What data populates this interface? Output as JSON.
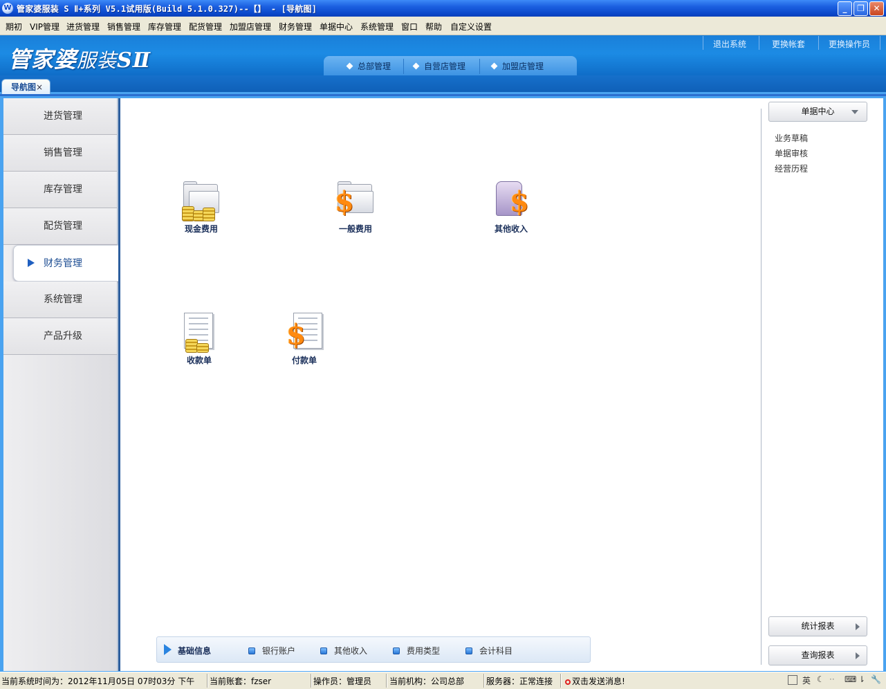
{
  "window": {
    "title": "管家婆服装 S Ⅱ+系列 V5.1试用版(Build 5.1.0.327)--【】 - [导航图]",
    "icon_text": "W",
    "controls": [
      "minimize-icon",
      "restore-icon",
      "close-icon"
    ],
    "accent": "#0a46c8"
  },
  "menubar": {
    "items": [
      "期初",
      "VIP管理",
      "进货管理",
      "销售管理",
      "库存管理",
      "配货管理",
      "加盟店管理",
      "财务管理",
      "单据中心",
      "系统管理",
      "窗口",
      "帮助",
      "自定义设置"
    ]
  },
  "header": {
    "logo": {
      "part1": "管家婆",
      "part2": "服装",
      "part3": "SⅡ"
    },
    "links": [
      "退出系统",
      "更换帐套",
      "更换操作员"
    ],
    "tabs": [
      "总部管理",
      "自营店管理",
      "加盟店管理"
    ]
  },
  "doc_tab": {
    "label": "导航图",
    "close": "×"
  },
  "sidebar": {
    "items": [
      "进货管理",
      "销售管理",
      "库存管理",
      "配货管理",
      "财务管理",
      "系统管理",
      "产品升级"
    ],
    "active": "财务管理"
  },
  "main": {
    "icons": [
      {
        "label": "现金费用",
        "icon": "folder-coins-icon"
      },
      {
        "label": "一般费用",
        "icon": "folder-dollar-icon"
      },
      {
        "label": "其他收入",
        "icon": "shirt-dollar-icon"
      },
      {
        "label": "收款单",
        "icon": "document-coins-icon"
      },
      {
        "label": "付款单",
        "icon": "document-dollar-icon"
      }
    ]
  },
  "right_panel": {
    "doc_center": "单据中心",
    "links": [
      "业务草稿",
      "单据审核",
      "经营历程"
    ],
    "stats_button": "统计报表",
    "query_button": "查询报表"
  },
  "basic_info": {
    "title": "基础信息",
    "items": [
      "银行账户",
      "其他收入",
      "费用类型",
      "会计科目"
    ]
  },
  "statusbar": {
    "time": "当前系统时间为：2012年11月05日 07时03分 下午",
    "account": "当前账套：fzser",
    "operator": "操作员：管理员",
    "org": "当前机构：公司总部",
    "server": "服务器：正常连接",
    "message": "双击发送消息!",
    "tray": {
      "ime": "英"
    }
  }
}
